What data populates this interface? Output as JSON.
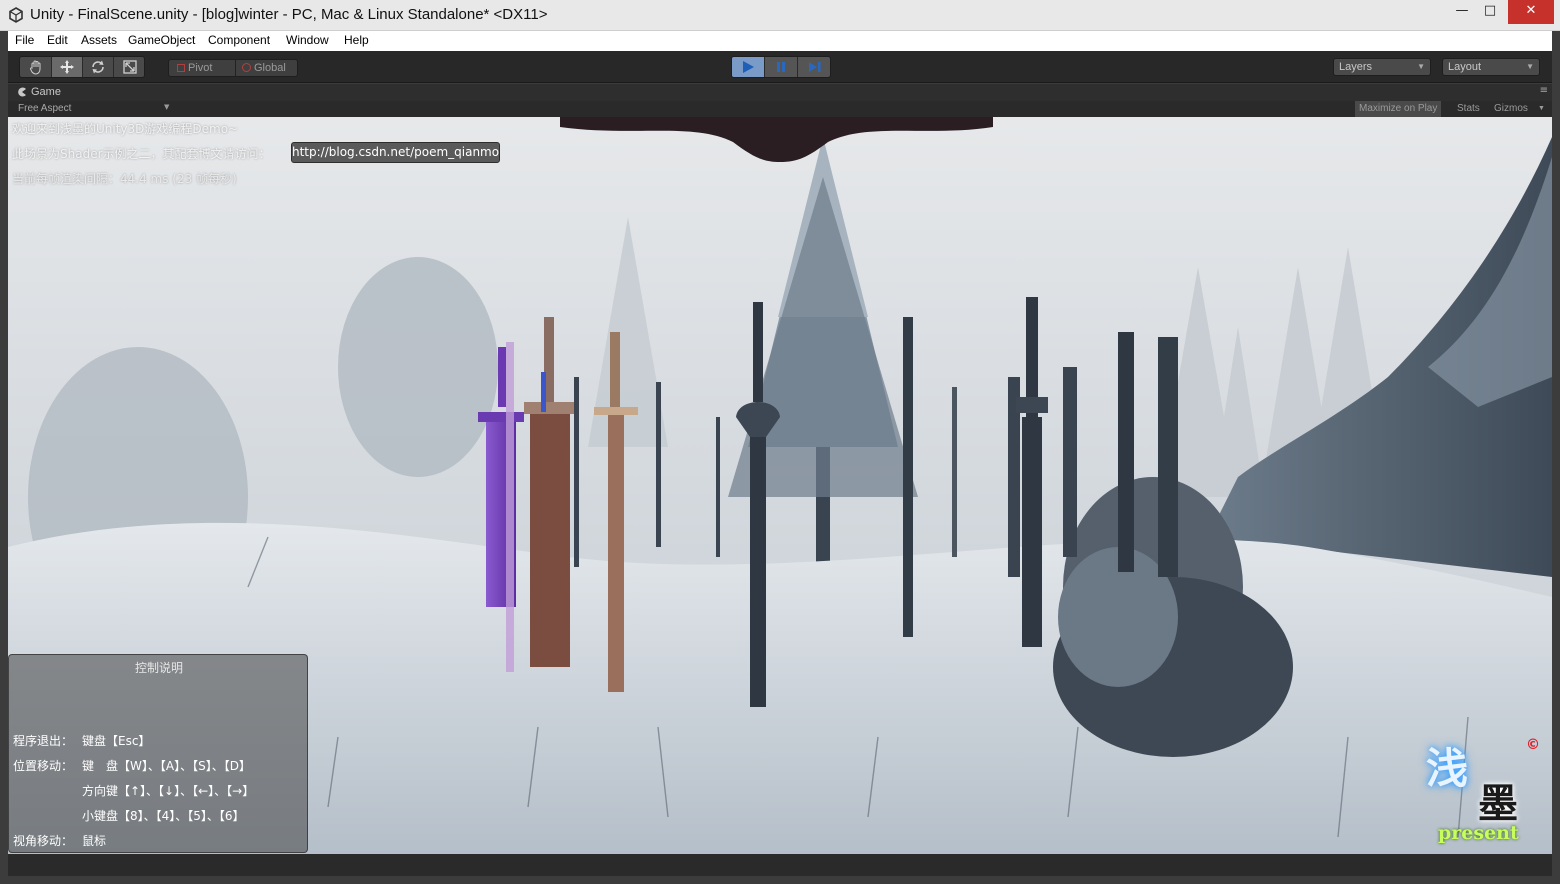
{
  "window": {
    "title": "Unity - FinalScene.unity - [blog]winter - PC, Mac & Linux Standalone* <DX11>",
    "minimize_label": "—",
    "maximize_label": "□",
    "close_label": "✕"
  },
  "menu": {
    "items": [
      "File",
      "Edit",
      "Assets",
      "GameObject",
      "Component",
      "Window",
      "Help"
    ]
  },
  "toolbar": {
    "transform_tools": [
      "hand-icon",
      "move-icon",
      "rotate-icon",
      "scale-icon"
    ],
    "pivot_label": "Pivot",
    "global_label": "Global",
    "playback": [
      "play-icon",
      "pause-icon",
      "step-icon"
    ],
    "layers_label": "Layers",
    "layout_label": "Layout",
    "accent_color": "#7a9ac8"
  },
  "game_view": {
    "tab_label": "Game",
    "aspect_label": "Free Aspect",
    "maximize_on_play": "Maximize on Play",
    "stats": "Stats",
    "gizmos": "Gizmos"
  },
  "overlay": {
    "welcome": "欢迎来到浅墨的Unity3D游戏编程Demo~",
    "shader_note": "此场景为Shader示例之二，其配套博文请访问：",
    "url": "http://blog.csdn.net/poem_qianmo",
    "frame_time": "当前每帧渲染间隔：44.4 ms (23 帧每秒)"
  },
  "controls": {
    "title": "控制说明",
    "exit_label": "程序退出：",
    "exit_value": "键盘【Esc】",
    "move_label": "位置移动：",
    "move_keyboard": "键　盘【W】、【A】、【S】、【D】",
    "move_arrows": "方向键【↑】、【↓】、【←】、【→】",
    "move_numpad": "小键盘【8】、【4】、【5】、【6】",
    "view_label": "视角移动：",
    "view_value": "鼠标"
  },
  "logo": {
    "glyph1": "浅",
    "glyph2": "墨",
    "present": "present",
    "copyright": "©"
  }
}
